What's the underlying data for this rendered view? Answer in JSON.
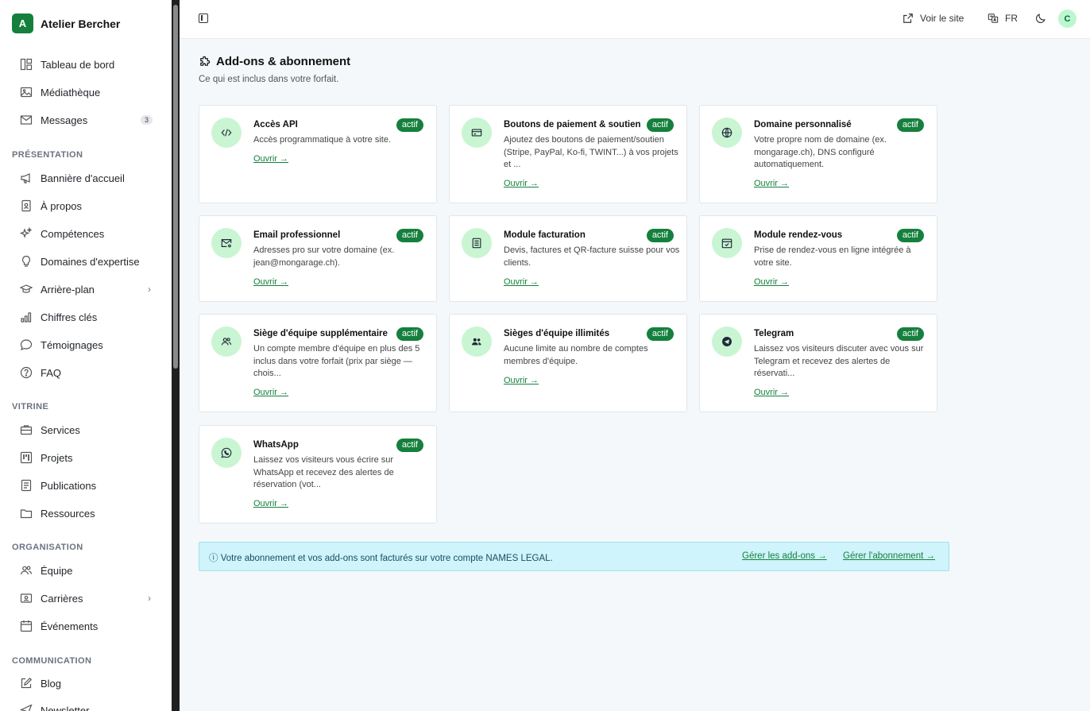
{
  "brand": {
    "logo_letter": "A",
    "name": "Atelier Bercher"
  },
  "sidebar": {
    "items": [
      {
        "label": "Tableau de bord"
      },
      {
        "label": "Médiathèque"
      },
      {
        "label": "Messages",
        "count": "3"
      },
      {
        "label": "Bannière d'accueil"
      },
      {
        "label": "À propos"
      },
      {
        "label": "Compétences"
      },
      {
        "label": "Domaines d'expertise"
      },
      {
        "label": "Arrière-plan"
      },
      {
        "label": "Chiffres clés"
      },
      {
        "label": "Témoignages"
      },
      {
        "label": "FAQ"
      },
      {
        "label": "Services"
      },
      {
        "label": "Projets"
      },
      {
        "label": "Publications"
      },
      {
        "label": "Ressources"
      },
      {
        "label": "Équipe"
      },
      {
        "label": "Carrières"
      },
      {
        "label": "Événements"
      },
      {
        "label": "Blog"
      },
      {
        "label": "Newsletter"
      }
    ],
    "sections": {
      "presentation": "PRÉSENTATION",
      "vitrine": "VITRINE",
      "organisation": "ORGANISATION",
      "communication": "COMMUNICATION"
    }
  },
  "topbar": {
    "view_site": "Voir le site",
    "language": "FR",
    "avatar_letter": "C"
  },
  "page": {
    "title": "Add-ons & abonnement",
    "subtitle": "Ce qui est inclus dans votre forfait."
  },
  "addons": [
    {
      "title": "Accès API",
      "badge": "actif",
      "description": "Accès programmatique à votre site.",
      "link": "Ouvrir →"
    },
    {
      "title": "Boutons de paiement & soutien",
      "badge": "actif",
      "description": "Ajoutez des boutons de paiement/soutien (Stripe, PayPal, Ko-fi, TWINT...) à vos projets et ...",
      "link": "Ouvrir →"
    },
    {
      "title": "Domaine personnalisé",
      "badge": "actif",
      "description": "Votre propre nom de domaine (ex. mongarage.ch), DNS configuré automatiquement.",
      "link": "Ouvrir →"
    },
    {
      "title": "Email professionnel",
      "badge": "actif",
      "description": "Adresses pro sur votre domaine (ex. jean@mongarage.ch).",
      "link": "Ouvrir →"
    },
    {
      "title": "Module facturation",
      "badge": "actif",
      "description": "Devis, factures et QR-facture suisse pour vos clients.",
      "link": "Ouvrir →"
    },
    {
      "title": "Module rendez-vous",
      "badge": "actif",
      "description": "Prise de rendez-vous en ligne intégrée à votre site.",
      "link": "Ouvrir →"
    },
    {
      "title": "Siège d'équipe supplémentaire",
      "badge": "actif",
      "description": "Un compte membre d'équipe en plus des 5 inclus dans votre forfait (prix par siège — chois...",
      "link": "Ouvrir →"
    },
    {
      "title": "Sièges d'équipe illimités",
      "badge": "actif",
      "description": "Aucune limite au nombre de comptes membres d'équipe.",
      "link": "Ouvrir →"
    },
    {
      "title": "Telegram",
      "badge": "actif",
      "description": "Laissez vos visiteurs discuter avec vous sur Telegram et recevez des alertes de réservati...",
      "link": "Ouvrir →"
    },
    {
      "title": "WhatsApp",
      "badge": "actif",
      "description": "Laissez vos visiteurs vous écrire sur WhatsApp et recevez des alertes de réservation (vot...",
      "link": "Ouvrir →"
    }
  ],
  "info": {
    "text": "ⓘ Votre abonnement et vos add-ons sont facturés sur votre compte NAMES LEGAL.",
    "manage_addons": "Gérer les add-ons →",
    "manage_subscription": "Gérer l'abonnement →"
  },
  "colors": {
    "accent": "#15803d",
    "icon_bg": "#c9f5d3",
    "info_bg": "#cff4fb"
  }
}
